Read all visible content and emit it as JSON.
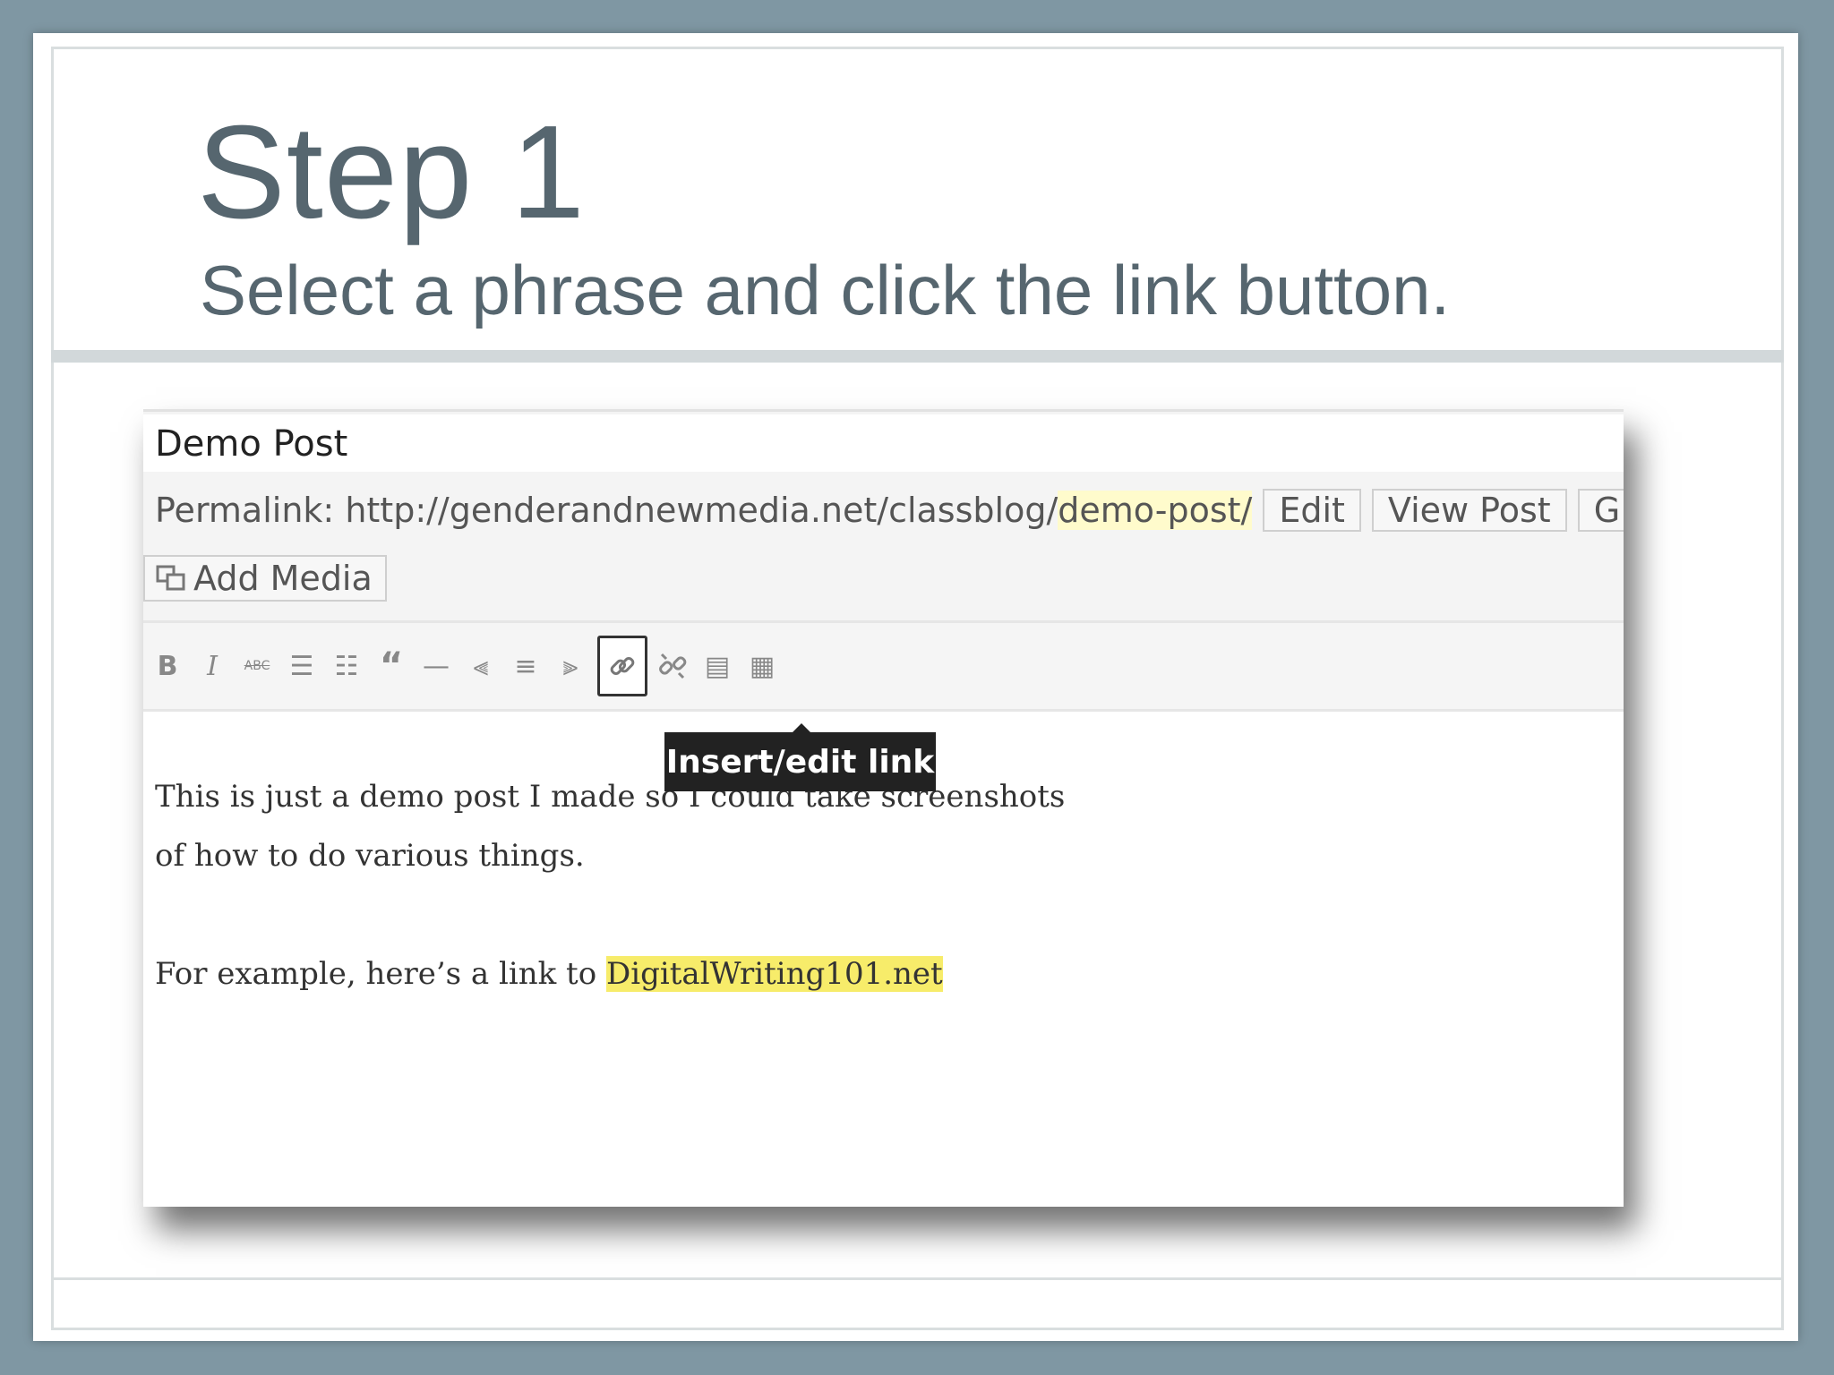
{
  "slide": {
    "title": "Step 1",
    "subtitle": "Select a phrase and click the link button."
  },
  "editor": {
    "post_title": "Demo Post",
    "permalink": {
      "label": "Permalink:",
      "base_url": "http://genderandnewmedia.net/classblog/",
      "slug": "demo-post/",
      "edit_button": "Edit",
      "view_button": "View Post",
      "get_button_partial": "G"
    },
    "add_media_label": "Add Media",
    "toolbar": {
      "buttons": [
        {
          "name": "bold",
          "glyph": "B"
        },
        {
          "name": "italic",
          "glyph": "I"
        },
        {
          "name": "strikethrough",
          "glyph": "ABC"
        },
        {
          "name": "bullet-list",
          "glyph": "☰"
        },
        {
          "name": "numbered-list",
          "glyph": "☷"
        },
        {
          "name": "blockquote",
          "glyph": "“"
        },
        {
          "name": "horizontal-rule",
          "glyph": "—"
        },
        {
          "name": "align-left",
          "glyph": "⫷"
        },
        {
          "name": "align-center",
          "glyph": "≡"
        },
        {
          "name": "align-right",
          "glyph": "⫸"
        },
        {
          "name": "insert-link",
          "glyph": "🔗",
          "active": true
        },
        {
          "name": "remove-link",
          "glyph": "⛓"
        },
        {
          "name": "read-more",
          "glyph": "▤"
        },
        {
          "name": "toolbar-toggle",
          "glyph": "▦"
        }
      ],
      "tooltip": "Insert/edit link"
    },
    "content": {
      "line1": "This is just a demo post I made so I could take screenshots",
      "line2": "of how to do various things.",
      "line3_prefix": "For example, here’s a link to ",
      "line3_highlight": "DigitalWriting101.net"
    }
  }
}
